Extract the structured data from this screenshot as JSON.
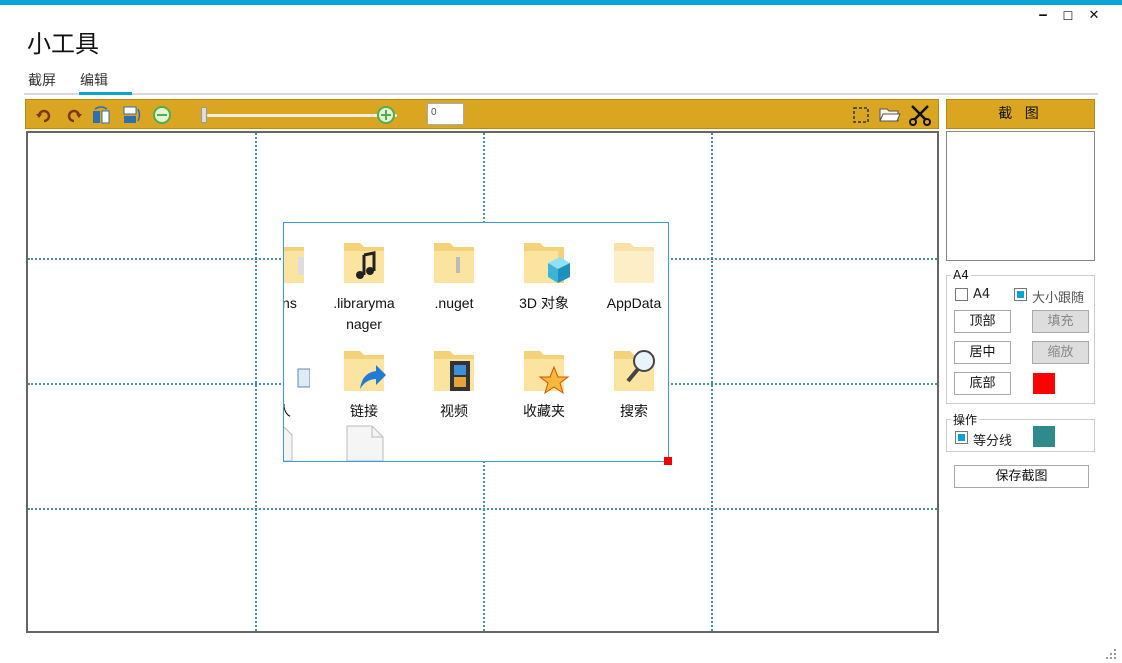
{
  "app": {
    "title": "小工具"
  },
  "window_controls": {
    "minimize": "‒",
    "maximize": "☐",
    "close": "✕"
  },
  "tabs": [
    {
      "label": "截屏"
    },
    {
      "label": "编辑",
      "active": true
    }
  ],
  "toolbar": {
    "icons": [
      "undo-icon",
      "redo-icon",
      "flip-horizontal-icon",
      "flip-vertical-icon",
      "zoom-out-icon",
      "zoom-in-icon",
      "select-region-icon",
      "open-folder-icon",
      "scissors-icon"
    ],
    "zoom_value": "0",
    "accent_color": "#daa520"
  },
  "canvas": {
    "folders": [
      {
        "label": "ains",
        "icon": "folder-icon"
      },
      {
        "label": ".libraryma nager",
        "icon": "music-folder-icon"
      },
      {
        "label": ".nuget",
        "icon": "folder-icon"
      },
      {
        "label": "3D 对象",
        "icon": "3d-objects-folder-icon"
      },
      {
        "label": "AppData",
        "icon": "folder-icon"
      },
      {
        "label": "人",
        "icon": "contacts-icon"
      },
      {
        "label": "链接",
        "icon": "links-folder-icon"
      },
      {
        "label": "视频",
        "icon": "videos-folder-icon"
      },
      {
        "label": "收藏夹",
        "icon": "favorites-folder-icon"
      },
      {
        "label": "搜索",
        "icon": "search-folder-icon"
      }
    ]
  },
  "side": {
    "capture_button": "截 图",
    "a4_group": {
      "title": "A4",
      "a4_checkbox": {
        "label": "A4",
        "checked": false
      },
      "follow_size_checkbox": {
        "label": "大小跟随",
        "checked": true
      },
      "top_button": "顶部",
      "fill_button": "填充",
      "center_button": "居中",
      "scale_button": "缩放",
      "bottom_button": "底部",
      "fill_color": "#ff0000"
    },
    "operation_group": {
      "title": "操作",
      "grid_checkbox": {
        "label": "等分线",
        "checked": true
      },
      "grid_color": "#2e8b8b"
    },
    "save_button": "保存截图"
  }
}
